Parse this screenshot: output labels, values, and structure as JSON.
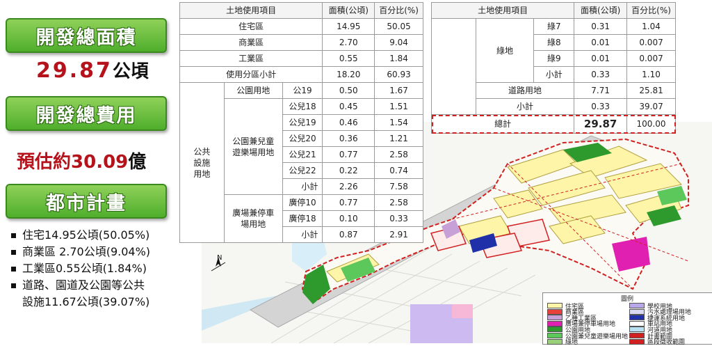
{
  "left": {
    "total_area_title": "開發總面積",
    "total_area_value": "29.87",
    "total_area_unit": "公頃",
    "total_cost_title": "開發總費用",
    "total_cost_prefix": "預估約",
    "total_cost_value": "30.09",
    "total_cost_unit": "億",
    "plan_title": "都市計畫",
    "bullets": [
      "住宅14.95公頃(50.05%)",
      "商業區 2.70公頃(9.04%)",
      "工業區0.55公頃(1.84%)",
      "道路、園道及公園等公共",
      "設施11.67公頃(39.07%)"
    ]
  },
  "table1": {
    "headers": [
      "土地使用項目",
      "面積(公頃)",
      "百分比(%)"
    ],
    "residential": [
      "住宅區",
      "14.95",
      "50.05"
    ],
    "commercial": [
      "商業區",
      "2.70",
      "9.04"
    ],
    "industrial": [
      "工業區",
      "0.55",
      "1.84"
    ],
    "zoning_subtotal": [
      "使用分區小計",
      "18.20",
      "60.93"
    ],
    "public_group": "公共設施用地",
    "park_label": "公園用地",
    "park_row": [
      "公19",
      "0.50",
      "1.67"
    ],
    "playground_label": "公園兼兒童遊樂場用地",
    "playground_rows": [
      [
        "公兒18",
        "0.45",
        "1.51"
      ],
      [
        "公兒19",
        "0.46",
        "1.54"
      ],
      [
        "公兒20",
        "0.36",
        "1.21"
      ],
      [
        "公兒21",
        "0.77",
        "2.58"
      ],
      [
        "公兒22",
        "0.22",
        "0.74"
      ],
      [
        "小計",
        "2.26",
        "7.58"
      ]
    ],
    "plaza_label": "廣場兼停車場用地",
    "plaza_rows": [
      [
        "廣停10",
        "0.77",
        "2.58"
      ],
      [
        "廣停18",
        "0.10",
        "0.33"
      ],
      [
        "小計",
        "0.87",
        "2.91"
      ]
    ]
  },
  "table2": {
    "headers": [
      "土地使用項目",
      "面積(公頃)",
      "百分比(%)"
    ],
    "green_label": "綠地",
    "green_rows": [
      [
        "綠7",
        "0.31",
        "1.04"
      ],
      [
        "綠8",
        "0.01",
        "0.007"
      ],
      [
        "綠9",
        "0.01",
        "0.007"
      ],
      [
        "小計",
        "0.33",
        "1.10"
      ]
    ],
    "road": [
      "道路用地",
      "7.71",
      "25.81"
    ],
    "subtotal": [
      "小計",
      "0.33",
      "39.07"
    ],
    "total": [
      "總計",
      "29.87",
      "100.00"
    ]
  },
  "map": {
    "north_label": "N",
    "legend_title": "圖例",
    "legend_items": [
      {
        "label": "住宅區",
        "color": "#fff5a8"
      },
      {
        "label": "商業區",
        "color": "#e8403a"
      },
      {
        "label": "乙種工業區",
        "color": "#c8a0d8"
      },
      {
        "label": "廣場兼停車場用地",
        "color": "#e020b0"
      },
      {
        "label": "公園用地",
        "color": "#2e9a2e"
      },
      {
        "label": "公園兼兒童遊樂場用地",
        "color": "#5cc85c"
      },
      {
        "label": "綠地",
        "color": "#9ad07a"
      },
      {
        "label": "學校用地",
        "color": "#b8a8e8"
      },
      {
        "label": "污水處理場用地",
        "color": "#d8d8f0"
      },
      {
        "label": "捷運系統用地",
        "color": "#2030a8"
      },
      {
        "label": "車站用地",
        "color": "#ffffff"
      },
      {
        "label": "河道用地",
        "color": "#b8e0f0"
      },
      {
        "label": "計畫範圍",
        "color": "#d02020"
      },
      {
        "label": "區段徵收範圍",
        "color": "#d02020"
      }
    ]
  },
  "colors": {
    "green_pill": "#4fae2c",
    "red_value": "#b5121b"
  }
}
